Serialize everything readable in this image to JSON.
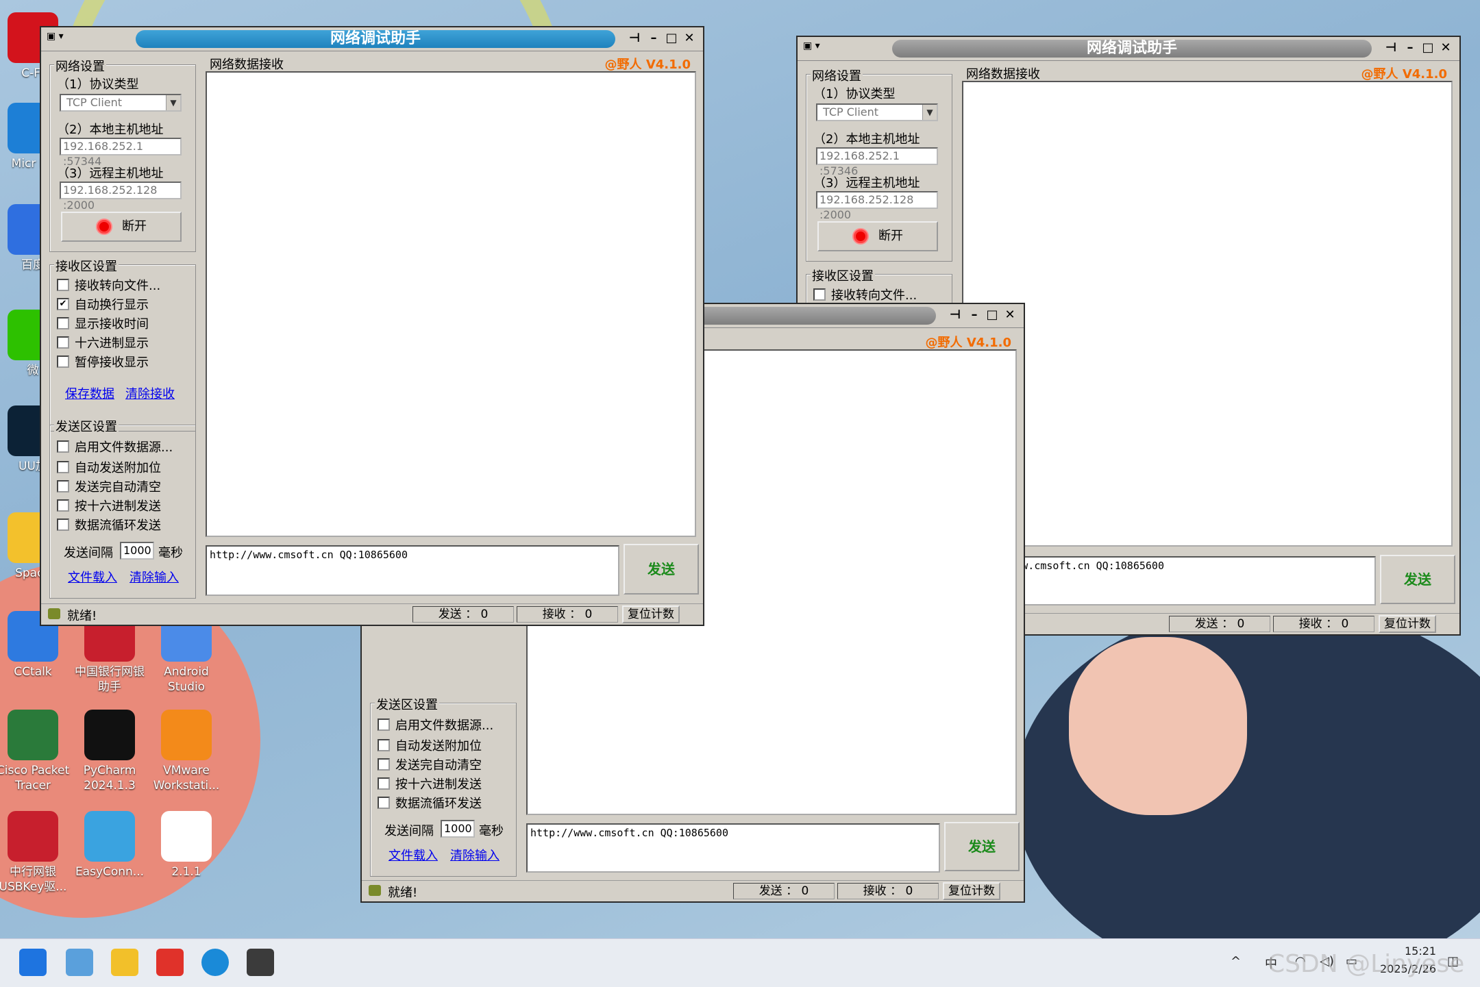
{
  "desktop": {
    "icons": [
      {
        "label": "C-Fr",
        "icon": "c-free-icon",
        "color": "#d3131c"
      },
      {
        "label": "Micr Ed",
        "icon": "edge-icon",
        "color": "#1d7fd6"
      },
      {
        "label": "百度",
        "icon": "baidu-icon",
        "color": "#2f6fe0"
      },
      {
        "label": "微",
        "icon": "wechat-icon",
        "color": "#2dc100"
      },
      {
        "label": "UU加",
        "icon": "uu-icon",
        "color": "#0c2236"
      },
      {
        "label": "Space",
        "icon": "folder-icon",
        "color": "#f3c12c"
      },
      {
        "label": "CCtalk",
        "icon": "cctalk-icon",
        "color": "#2e7ae0"
      },
      {
        "label": "中国银行网银助手",
        "icon": "boc-icon",
        "color": "#c71f2d"
      },
      {
        "label": "Android Studio",
        "icon": "android-studio-icon",
        "color": "#4b8be8"
      },
      {
        "label": "Cisco Packet Tracer",
        "icon": "packet-tracer-icon",
        "color": "#2a7a3a"
      },
      {
        "label": "PyCharm 2024.1.3",
        "icon": "pycharm-icon",
        "color": "#111111"
      },
      {
        "label": "VMware Workstati...",
        "icon": "vmware-icon",
        "color": "#f38a1a"
      },
      {
        "label": "中行网银USBKey驱...",
        "icon": "boc-usbkey-icon",
        "color": "#c71f2d"
      },
      {
        "label": "EasyConn...",
        "icon": "easyconnect-icon",
        "color": "#3aa3e0"
      },
      {
        "label": "2.1.1",
        "icon": "file-icon",
        "color": "#ffffff"
      }
    ]
  },
  "common": {
    "app_title": "网络调试助手",
    "version": "@野人 V4.1.0",
    "net_group": "网络设置",
    "proto_label": "（1）协议类型",
    "proto_value": "TCP Client",
    "local_label": "（2）本地主机地址",
    "remote_label": "（3）远程主机地址",
    "remote_value": "192.168.252.128 :2000",
    "disconnect_label": "断开",
    "recv_group": "接收区设置",
    "recv_options": [
      "接收转向文件...",
      "自动换行显示",
      "显示接收时间",
      "十六进制显示",
      "暂停接收显示"
    ],
    "save_link": "保存数据",
    "clear_recv_link": "清除接收",
    "send_group": "发送区设置",
    "send_options": [
      "启用文件数据源...",
      "自动发送附加位",
      "发送完自动清空",
      "按十六进制发送",
      "数据流循环发送"
    ],
    "interval_label": "发送间隔",
    "interval_value": "1000",
    "interval_unit": "毫秒",
    "load_file_link": "文件载入",
    "clear_input_link": "清除输入",
    "recv_header": "网络数据接收",
    "send_text": "http://www.cmsoft.cn QQ:10865600",
    "send_text_partial": ".cmsoft.cn QQ:10865600",
    "send_button": "发送",
    "status_ready": "就绪!",
    "sent_counter": "发送 ： 0",
    "recv_counter": "接收 ： 0",
    "reset_button": "复位计数",
    "partial_title": "试助手"
  },
  "window_front": {
    "local_value": "192.168.252.1 :57344",
    "auto_wrap_checked": true
  },
  "window_right": {
    "local_value": "192.168.252.1 :57346"
  },
  "taskbar": {
    "apps": [
      "start-icon",
      "explorer-window-icon",
      "folder-icon",
      "wps-icon",
      "edge-icon",
      "network-tool-icon"
    ],
    "tray_ime": "中",
    "time": "15:21",
    "date": "2025/2/26",
    "watermark": "CSDN @Linyese"
  }
}
